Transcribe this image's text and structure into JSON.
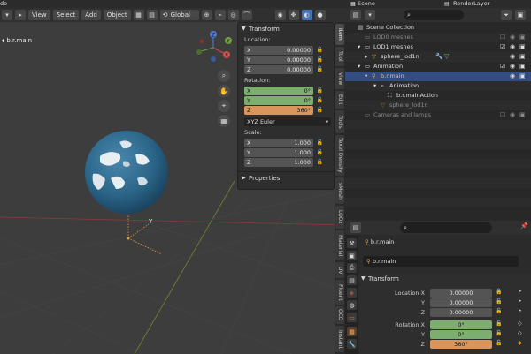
{
  "viewport": {
    "top_strip_label": "de",
    "header": {
      "menus": [
        "View",
        "Select",
        "Add",
        "Object"
      ],
      "orientation": "Global"
    },
    "object_label": "b.r.main",
    "gizmo": {
      "x": "X",
      "y": "Y",
      "z": "Z"
    },
    "origin_axis_label": "Y"
  },
  "npanel": {
    "transform_title": "Transform",
    "location_label": "Location:",
    "location": [
      {
        "axis": "X",
        "value": "0.00000"
      },
      {
        "axis": "Y",
        "value": "0.00000"
      },
      {
        "axis": "Z",
        "value": "0.00000"
      }
    ],
    "rotation_label": "Rotation:",
    "rotation": [
      {
        "axis": "X",
        "value": "0°"
      },
      {
        "axis": "Y",
        "value": "0°"
      },
      {
        "axis": "Z",
        "value": "360°"
      }
    ],
    "rotation_mode": "XYZ Euler",
    "scale_label": "Scale:",
    "scale": [
      {
        "axis": "X",
        "value": "1.000"
      },
      {
        "axis": "Y",
        "value": "1.000"
      },
      {
        "axis": "Z",
        "value": "1.000"
      }
    ],
    "properties_title": "Properties"
  },
  "side_tabs": [
    "Item",
    "Tool",
    "View",
    "Edit",
    "Tools",
    "Texel Density",
    "sMesh",
    "LODz",
    "Material",
    "UV",
    "Fluent",
    "OCD",
    "Instant"
  ],
  "outliner": {
    "scene": "Scene",
    "render_layer": "RenderLayer",
    "rows": [
      {
        "label": "Scene Collection"
      },
      {
        "label": "LOD0 meshes"
      },
      {
        "label": "LOD1 meshes"
      },
      {
        "label": "sphere_lod1n"
      },
      {
        "label": "Animation"
      },
      {
        "label": "b.r.main"
      },
      {
        "label": "Animation"
      },
      {
        "label": "b.r.mainAction"
      },
      {
        "label": "sphere_lod1n"
      },
      {
        "label": "Cameras and lamps"
      }
    ]
  },
  "properties": {
    "object_name": "b.r.main",
    "name_field": "b.r.main",
    "transform_title": "Transform",
    "location_label": "Location X",
    "rotation_label": "Rotation X",
    "axis_y": "Y",
    "axis_z": "Z",
    "location": [
      "0.00000",
      "0.00000",
      "0.00000"
    ],
    "rotation": [
      "0°",
      "0°",
      "360°"
    ]
  },
  "colors": {
    "accent": "#4772b3",
    "animated": "#7bae6f",
    "keyframed": "#d9955a",
    "selected_row": "#334d80"
  }
}
